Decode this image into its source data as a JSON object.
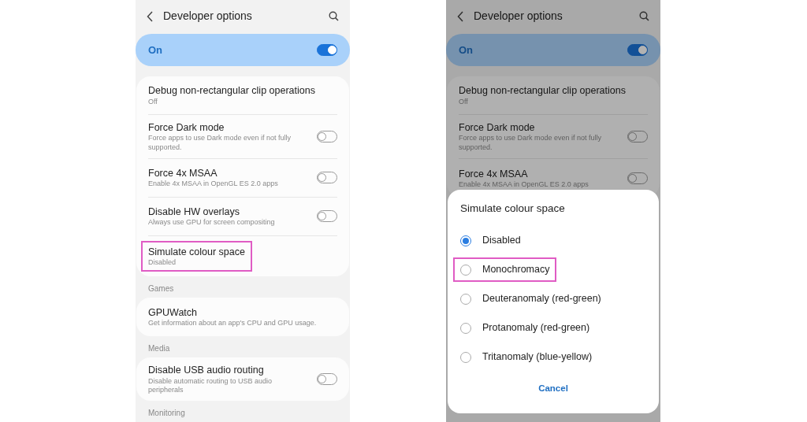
{
  "screens": [
    {
      "title": "Developer options",
      "master": {
        "label": "On",
        "on": true
      },
      "dimmed": false,
      "groups": [
        {
          "items": [
            {
              "kind": "plain",
              "title": "Debug non-rectangular clip operations",
              "subtitle": "Off",
              "highlighted": false
            },
            {
              "kind": "toggle",
              "title": "Force Dark mode",
              "subtitle": "Force apps to use Dark mode even if not fully supported.",
              "on": false,
              "highlighted": false
            },
            {
              "kind": "toggle",
              "title": "Force 4x MSAA",
              "subtitle": "Enable 4x MSAA in OpenGL ES 2.0 apps",
              "on": false,
              "highlighted": false
            },
            {
              "kind": "toggle",
              "title": "Disable HW overlays",
              "subtitle": "Always use GPU for screen compositing",
              "on": false,
              "highlighted": false
            },
            {
              "kind": "plain",
              "title": "Simulate colour space",
              "subtitle": "Disabled",
              "highlighted": true
            }
          ]
        },
        {
          "heading": "Games",
          "items": [
            {
              "kind": "plain",
              "title": "GPUWatch",
              "subtitle": "Get information about an app's CPU and GPU usage.",
              "highlighted": false
            }
          ]
        },
        {
          "heading": "Media",
          "items": [
            {
              "kind": "toggle",
              "title": "Disable USB audio routing",
              "subtitle": "Disable automatic routing to USB audio peripherals",
              "on": false,
              "highlighted": false
            }
          ]
        },
        {
          "heading": "Monitoring"
        }
      ]
    },
    {
      "title": "Developer options",
      "master": {
        "label": "On",
        "on": true
      },
      "dimmed": true,
      "groups": [
        {
          "items": [
            {
              "kind": "plain",
              "title": "Debug non-rectangular clip operations",
              "subtitle": "Off",
              "highlighted": false
            },
            {
              "kind": "toggle",
              "title": "Force Dark mode",
              "subtitle": "Force apps to use Dark mode even if not fully supported.",
              "on": false,
              "highlighted": false
            },
            {
              "kind": "toggle",
              "title": "Force 4x MSAA",
              "subtitle": "Enable 4x MSAA in OpenGL ES 2.0 apps",
              "on": false,
              "highlighted": false
            }
          ]
        }
      ],
      "dialog": {
        "title": "Simulate colour space",
        "options": [
          {
            "label": "Disabled",
            "selected": true,
            "highlighted": false
          },
          {
            "label": "Monochromacy",
            "selected": false,
            "highlighted": true
          },
          {
            "label": "Deuteranomaly (red-green)",
            "selected": false,
            "highlighted": false
          },
          {
            "label": "Protanomaly (red-green)",
            "selected": false,
            "highlighted": false
          },
          {
            "label": "Tritanomaly (blue-yellow)",
            "selected": false,
            "highlighted": false
          }
        ],
        "cancel": "Cancel"
      }
    }
  ]
}
